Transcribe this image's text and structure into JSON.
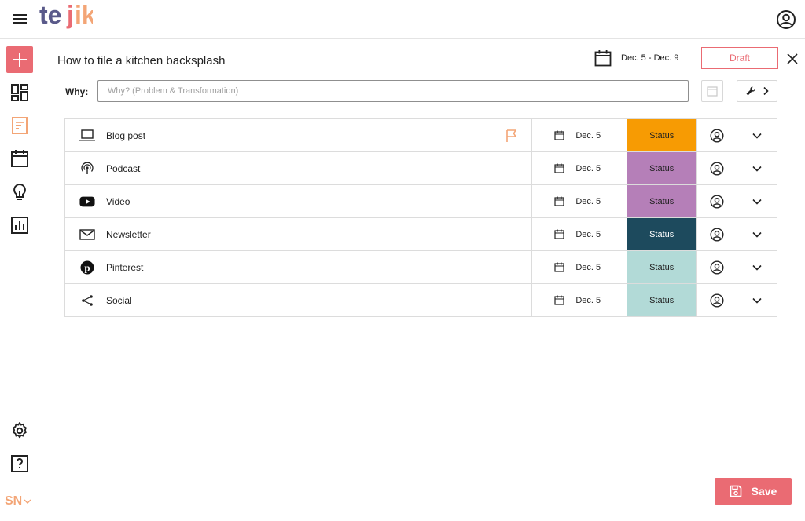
{
  "app": {
    "logo_text": "tejik",
    "brand_colors": {
      "accent": "#ea6b73",
      "orange": "#f3a576",
      "purple": "#5a5a8a"
    }
  },
  "sidebar": {
    "items": [
      {
        "icon": "plus-icon",
        "active": false
      },
      {
        "icon": "dashboard-icon"
      },
      {
        "icon": "document-icon",
        "active": true
      },
      {
        "icon": "calendar-icon"
      },
      {
        "icon": "lightbulb-icon"
      },
      {
        "icon": "bar-chart-icon"
      }
    ],
    "bottom": [
      {
        "icon": "gear-icon"
      },
      {
        "icon": "help-icon"
      }
    ],
    "initials": "SN"
  },
  "header": {
    "title": "How to tile a kitchen backsplash",
    "date_range": "Dec. 5 - Dec. 9",
    "draft_label": "Draft"
  },
  "why": {
    "label": "Why:",
    "placeholder": "Why? (Problem & Transformation)",
    "value": ""
  },
  "rows": [
    {
      "label": "Blog post",
      "icon": "laptop-icon",
      "flagged": true,
      "date": "Dec. 5",
      "status": "Status",
      "status_color": "#f79b03"
    },
    {
      "label": "Podcast",
      "icon": "podcast-icon",
      "flagged": false,
      "date": "Dec. 5",
      "status": "Status",
      "status_color": "#b57fb8"
    },
    {
      "label": "Video",
      "icon": "youtube-icon",
      "flagged": false,
      "date": "Dec. 5",
      "status": "Status",
      "status_color": "#b57fb8"
    },
    {
      "label": "Newsletter",
      "icon": "mail-icon",
      "flagged": false,
      "date": "Dec. 5",
      "status": "Status",
      "status_color": "#1d4a5d"
    },
    {
      "label": "Pinterest",
      "icon": "pinterest-icon",
      "flagged": false,
      "date": "Dec. 5",
      "status": "Status",
      "status_color": "#b2dad7"
    },
    {
      "label": "Social",
      "icon": "share-icon",
      "flagged": false,
      "date": "Dec. 5",
      "status": "Status",
      "status_color": "#b2dad7"
    }
  ],
  "save_label": "Save"
}
